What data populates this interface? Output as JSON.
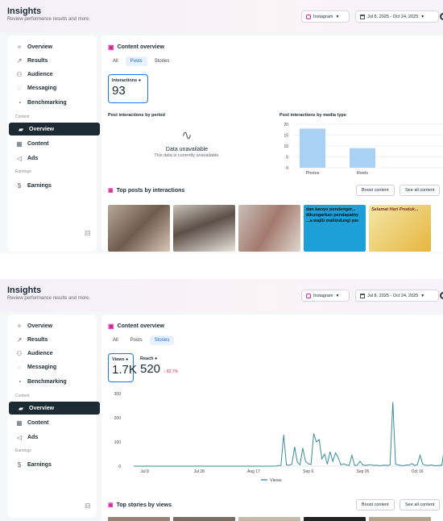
{
  "app": {
    "title": "Insights",
    "subtitle": "Review performance results and more."
  },
  "header": {
    "account": "Instagram",
    "date_range": "Jul 8, 2025 - Oct 24, 2025"
  },
  "sidebar": {
    "items": [
      {
        "label": "Overview",
        "icon": "sparkle-icon"
      },
      {
        "label": "Results",
        "icon": "trend-icon"
      },
      {
        "label": "Audience",
        "icon": "people-icon"
      },
      {
        "label": "Messaging",
        "icon": "chat-icon"
      },
      {
        "label": "Benchmarking",
        "icon": "benchmark-icon"
      }
    ],
    "content_section": "Content",
    "content_items": [
      {
        "label": "Overview",
        "icon": "folder-icon"
      },
      {
        "label": "Content",
        "icon": "grid-icon"
      },
      {
        "label": "Ads",
        "icon": "megaphone-icon"
      }
    ],
    "earnings_section": "Earnings",
    "earnings_items": [
      {
        "label": "Earnings",
        "icon": "dollar-icon"
      }
    ]
  },
  "screen1": {
    "card_title": "Content overview",
    "tabs": [
      "All",
      "Posts",
      "Stories"
    ],
    "active_tab": "Posts",
    "metric": {
      "label": "Interactions",
      "value": "93"
    },
    "period_title": "Post interactions by period",
    "unavailable_title": "Data unavailable",
    "unavailable_sub": "This data is currently unavailable.",
    "media_title": "Post interactions by media type",
    "top_title": "Top posts by interactions",
    "boost": "Boost content",
    "see_all": "See all content",
    "thumb_texts": [
      "",
      "",
      "",
      "dan banyo pendenger... dikungarkan pendapatny ...a wajib mallindungi per",
      "Selamat Hari Produk..."
    ]
  },
  "screen2": {
    "card_title": "Content overview",
    "tabs": [
      "All",
      "Posts",
      "Stories"
    ],
    "active_tab": "Stories",
    "views": {
      "label": "Views",
      "value": "1.7K"
    },
    "reach": {
      "label": "Reach",
      "value": "520",
      "delta": "↓ 82.7%"
    },
    "legend": "Views",
    "top_title": "Top stories by views",
    "boost": "Boost content",
    "see_all": "See all content"
  },
  "chart_data": [
    {
      "type": "bar",
      "title": "Post interactions by media type",
      "categories": [
        "Photos",
        "Reels"
      ],
      "values": [
        18,
        9
      ],
      "ylim": [
        0,
        20
      ],
      "yticks": [
        0,
        5,
        10,
        15,
        20
      ],
      "colors": [
        "#a8d1f4",
        "#a8d1f4"
      ]
    },
    {
      "type": "line",
      "title": "",
      "series": [
        {
          "name": "Views",
          "color": "#3a8c9a",
          "values": [
            0,
            0,
            0,
            0,
            0,
            0,
            0,
            0,
            0,
            0,
            0,
            0,
            0,
            0,
            0,
            0,
            0,
            0,
            0,
            0,
            0,
            0,
            0,
            0,
            0,
            0,
            0,
            0,
            0,
            0,
            0,
            0,
            0,
            0,
            0,
            0,
            0,
            0,
            0,
            0,
            0,
            0,
            0,
            0,
            0,
            0,
            0,
            0,
            0,
            0,
            0,
            0,
            0,
            2,
            3,
            130,
            5,
            4,
            8,
            80,
            15,
            6,
            75,
            20,
            10,
            7,
            135,
            100,
            110,
            30,
            50,
            8,
            60,
            20,
            55,
            35,
            5,
            10,
            5,
            3,
            45,
            3,
            4,
            20,
            5,
            3,
            5,
            6,
            3,
            4,
            2,
            3,
            4,
            3,
            5,
            265,
            8,
            5,
            3,
            2,
            5,
            4,
            10,
            3,
            6,
            45,
            8,
            4,
            3,
            5,
            3,
            2,
            3,
            4,
            85
          ]
        }
      ],
      "x_ticks": [
        "Jul 8",
        "Jul 28",
        "Aug 17",
        "Sep 6",
        "Sep 26",
        "Oct 16"
      ],
      "ylim": [
        0,
        300
      ],
      "yticks": [
        0,
        100,
        200,
        300
      ]
    }
  ]
}
